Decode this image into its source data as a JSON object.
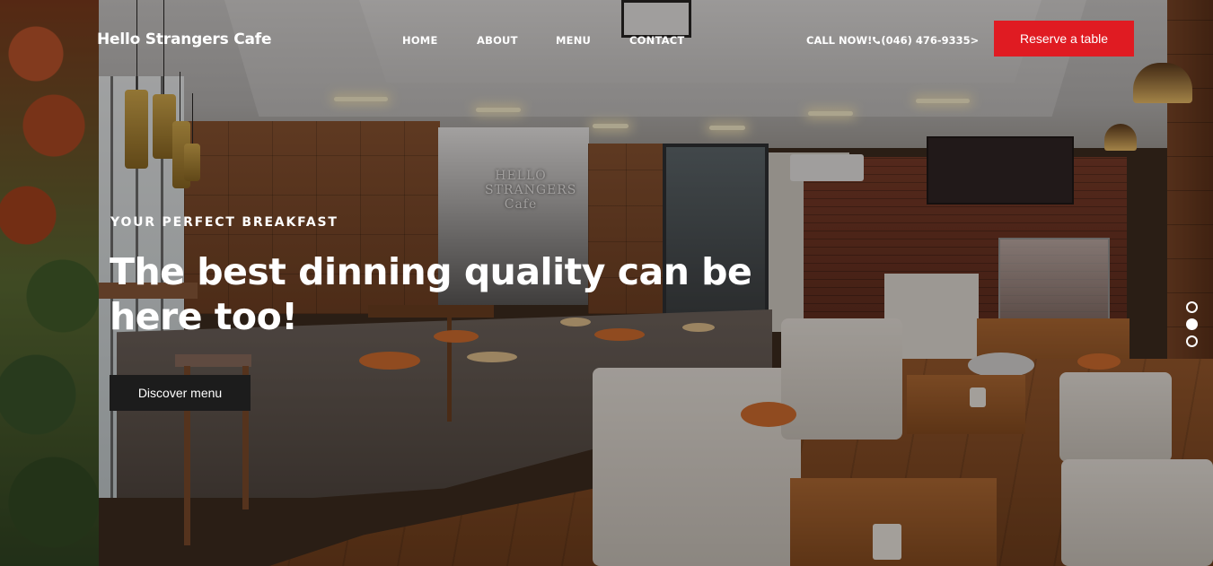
{
  "brand": {
    "name": "Hello Strangers Cafe"
  },
  "nav": {
    "items": [
      {
        "label": "HOME"
      },
      {
        "label": "ABOUT"
      },
      {
        "label": "MENU"
      },
      {
        "label": "CONTACT"
      }
    ],
    "call_label": "CALL NOW!",
    "phone": "(046) 476-9335>",
    "phone_icon": "phone-icon",
    "reserve_label": "Reserve a table"
  },
  "hero": {
    "eyebrow": "YOUR PERFECT BREAKFAST",
    "headline": "The best dinning quality can be here too!",
    "cta_label": "Discover menu",
    "background_image_text": "HELLO STRANGERS Cafe",
    "slides": {
      "count": 3,
      "active_index": 1
    }
  },
  "colors": {
    "accent": "#e01b22",
    "cta_dark": "#1c1c1c",
    "text": "#ffffff"
  }
}
